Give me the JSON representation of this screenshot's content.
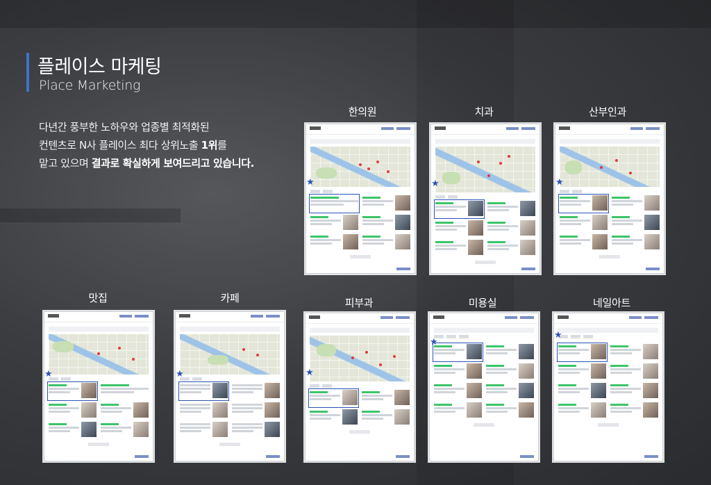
{
  "heading": {
    "title_ko": "플레이스 마케팅",
    "title_en": "Place Marketing"
  },
  "description": {
    "line1": "다년간 풍부한 노하우와 업종별 최적화된",
    "line2_a": "컨텐츠로 N사 플레이스 최다 상위노출 ",
    "line2_b": "1위",
    "line2_c": "를",
    "line3_a": "맡고 있으며 ",
    "line3_b": "결과로 확실하게 보여드리고 있습니다."
  },
  "categories": {
    "c1": "한의원",
    "c2": "치과",
    "c3": "산부인과",
    "c4": "맛집",
    "c5": "카페",
    "c6": "피부과",
    "c7": "미용실",
    "c8": "네일아트"
  },
  "icons": {
    "rank_marker": "star-icon"
  },
  "colors": {
    "accent": "#3f73c9",
    "highlight": "#2a53b5",
    "naver_green": "#3cc468"
  }
}
